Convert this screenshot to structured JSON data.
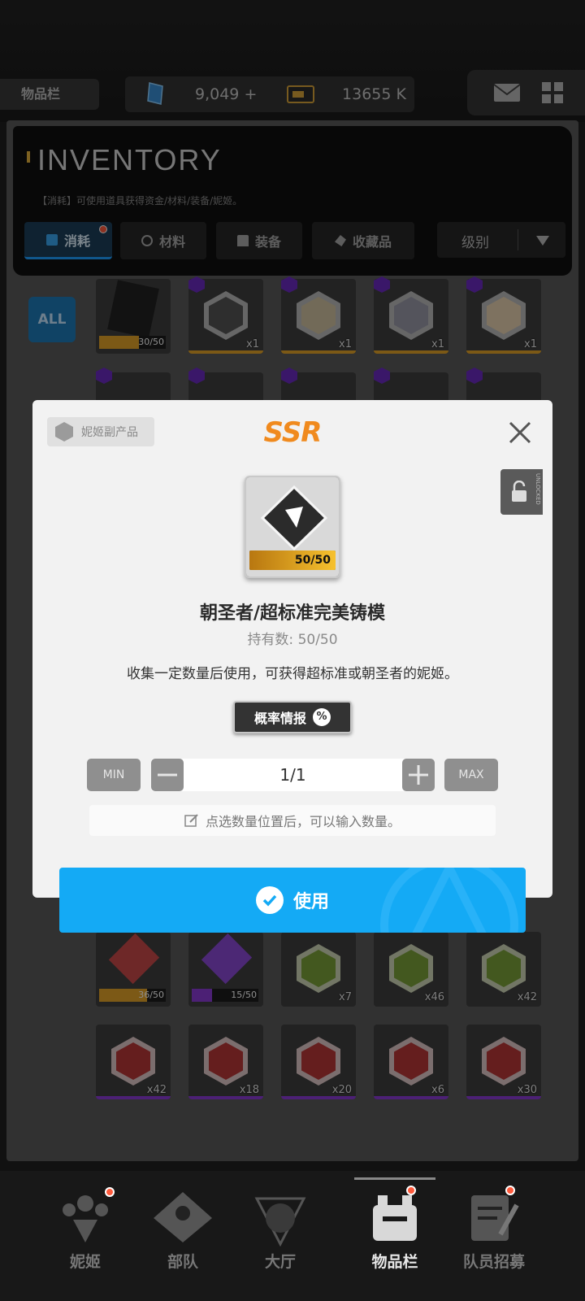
{
  "topbar": {
    "location": "物品栏",
    "gems": "9,049",
    "gems_add": "+",
    "credits": "13655 K"
  },
  "inventory": {
    "title": "INVENTORY",
    "description": "【消耗】可使用道具获得资金/材料/装备/妮姬。",
    "tabs": [
      {
        "label": "消耗",
        "active": true
      },
      {
        "label": "材料",
        "active": false
      },
      {
        "label": "装备",
        "active": false
      },
      {
        "label": "收藏品",
        "active": false
      }
    ],
    "sort_label": "级别",
    "all_label": "ALL",
    "row1": [
      {
        "type": "progress",
        "text": "30/50",
        "fill": 0.6,
        "color": "#e2a328"
      },
      {
        "qty": "x1",
        "hex": "#888"
      },
      {
        "qty": "x1",
        "hex": "#888"
      },
      {
        "qty": "x1",
        "hex": "#888"
      },
      {
        "qty": "x1",
        "hex": "#888"
      }
    ],
    "row3": [
      {
        "type": "progress",
        "text": "36/50",
        "fill": 0.72,
        "color": "#e2a328"
      },
      {
        "type": "progress",
        "text": "15/50",
        "fill": 0.3,
        "color": "#8a3bd6"
      },
      {
        "qty": "x7",
        "hex": "#7aa03a"
      },
      {
        "qty": "x46",
        "hex": "#7aa03a"
      },
      {
        "qty": "x42",
        "hex": "#7aa03a"
      }
    ],
    "row4": [
      {
        "qty": "x42",
        "hex": "#b83838"
      },
      {
        "qty": "x18",
        "hex": "#b83838"
      },
      {
        "qty": "x20",
        "hex": "#b83838"
      },
      {
        "qty": "x6",
        "hex": "#b83838"
      },
      {
        "qty": "x30",
        "hex": "#b83838"
      }
    ]
  },
  "modal": {
    "category": "妮姬副产品",
    "rarity": "SSR",
    "lock_text": "UNLOCKED",
    "progress_text": "50/50",
    "progress_fill": 1.0,
    "name": "朝圣者/超标准完美铸模",
    "hold": "持有数: 50/50",
    "description": "收集一定数量后使用，可获得超标准或朝圣者的妮姬。",
    "prob_label": "概率情报",
    "prob_icon": "%",
    "min_label": "MIN",
    "max_label": "MAX",
    "quantity": "1/1",
    "hint": "点选数量位置后，可以输入数量。",
    "use_label": "使用"
  },
  "nav": {
    "items": [
      {
        "label": "妮姬",
        "icon": "nikke-icon",
        "dot": true
      },
      {
        "label": "部队",
        "icon": "squad-icon",
        "dot": false
      },
      {
        "label": "大厅",
        "icon": "lobby-icon",
        "dot": false
      },
      {
        "label": "物品栏",
        "icon": "inventory-icon",
        "dot": true,
        "active": true
      },
      {
        "label": "队员招募",
        "icon": "recruit-icon",
        "dot": true
      }
    ]
  }
}
